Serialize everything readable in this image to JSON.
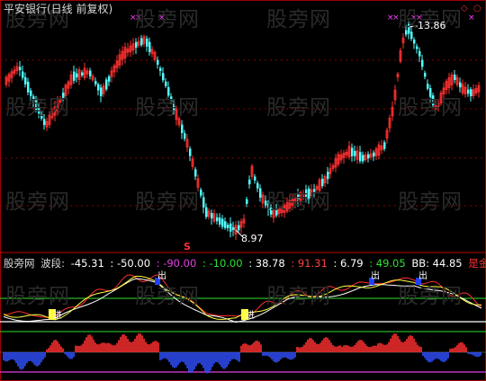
{
  "title": "平安银行(日线 前复权)",
  "watermark": "股旁网",
  "price": {
    "high_label": "13.86",
    "low_label": "8.97",
    "signal_s": "S"
  },
  "indicator": {
    "name": "股旁网",
    "label": "波段:",
    "values": [
      {
        "text": "-45.31",
        "color": "#ffffff"
      },
      {
        "text": ": -50.00",
        "color": "#ffffff"
      },
      {
        "text": ": -90.00",
        "color": "#e040e0"
      },
      {
        "text": ": -10.00",
        "color": "#30e030"
      },
      {
        "text": ": 38.78",
        "color": "#ffffff"
      },
      {
        "text": ": 91.31",
        "color": "#ff4040"
      },
      {
        "text": ": 6.79",
        "color": "#ffffff"
      },
      {
        "text": ": 49.05",
        "color": "#30e030"
      },
      {
        "text": "BB: 44.85",
        "color": "#ffffff"
      },
      {
        "text": "是金:",
        "color": "#ff3030"
      }
    ],
    "signal_out": "出",
    "signal_in": "进"
  },
  "colors": {
    "up": "#ff3030",
    "down": "#54ffff",
    "grid": "#8b0000",
    "fast": "#ffff40",
    "slow": "#ffffff",
    "cross": "#ff40ff"
  },
  "controls": [
    "diamond-icon",
    "circle-icon"
  ]
}
